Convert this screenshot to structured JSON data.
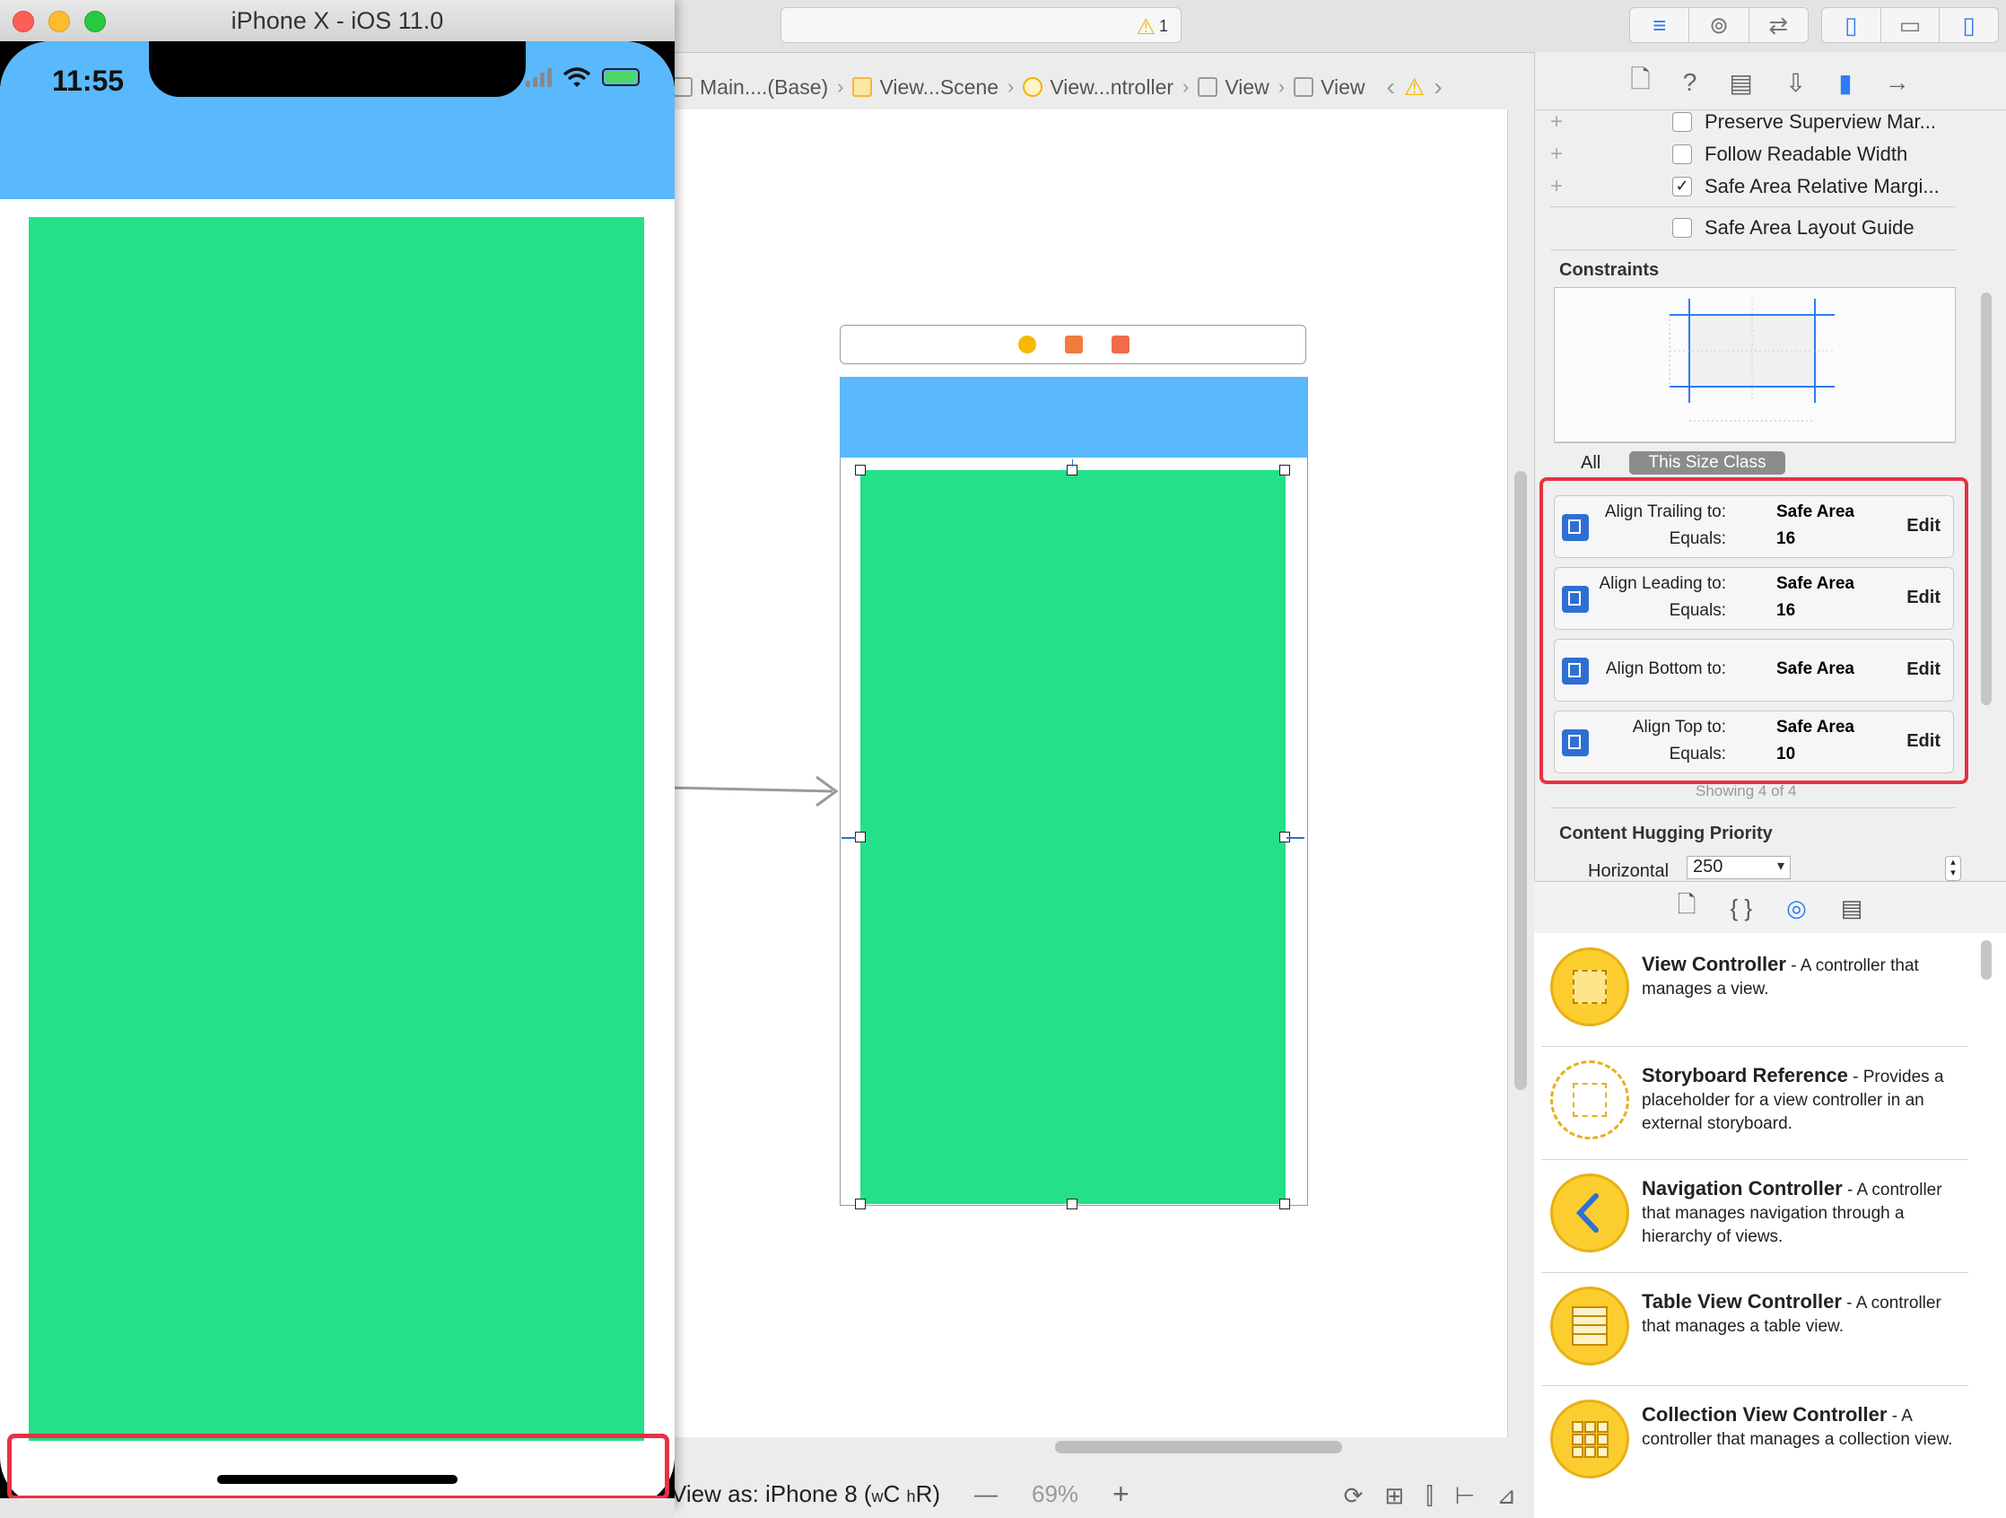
{
  "simulator": {
    "window_title": "iPhone X - iOS 11.0",
    "time": "11:55",
    "colors": {
      "nav_bar": "#5ab8fc",
      "content_view": "#24e088"
    }
  },
  "toolbar": {
    "activity_warning_count": "1"
  },
  "jumpbar": {
    "items": [
      "Main....(Base)",
      "View...Scene",
      "View...ntroller",
      "View",
      "View"
    ]
  },
  "canvas": {
    "view_as": "View as: iPhone 8 (",
    "view_as_w": "w",
    "view_as_c": "C ",
    "view_as_h": "h",
    "view_as_r": "R)",
    "zoom_minus": "—",
    "zoom_level": "69%",
    "zoom_plus": "+"
  },
  "inspector": {
    "checkboxes": [
      {
        "label": "Preserve Superview Mar...",
        "checked": false
      },
      {
        "label": "Follow Readable Width",
        "checked": false
      },
      {
        "label": "Safe Area Relative Margi...",
        "checked": true
      },
      {
        "label": "Safe Area Layout Guide",
        "checked": false
      }
    ],
    "constraints_title": "Constraints",
    "filter_all": "All",
    "filter_size_class": "This Size Class",
    "constraints": [
      {
        "label": "Align Trailing to:",
        "target": "Safe Area",
        "equals_label": "Equals:",
        "equals": "16",
        "edit": "Edit"
      },
      {
        "label": "Align Leading to:",
        "target": "Safe Area",
        "equals_label": "Equals:",
        "equals": "16",
        "edit": "Edit"
      },
      {
        "label": "Align Bottom to:",
        "target": "Safe Area",
        "edit": "Edit"
      },
      {
        "label": "Align Top to:",
        "target": "Safe Area",
        "equals_label": "Equals:",
        "equals": "10",
        "edit": "Edit"
      }
    ],
    "showing": "Showing 4 of 4",
    "hugging_title": "Content Hugging Priority",
    "horizontal_label": "Horizontal",
    "horizontal_value": "250"
  },
  "library": {
    "items": [
      {
        "name": "View Controller",
        "desc": " - A controller that manages a view."
      },
      {
        "name": "Storyboard Reference",
        "desc": " - Provides a placeholder for a view controller in an external storyboard."
      },
      {
        "name": "Navigation Controller",
        "desc": " - A controller that manages navigation through a hierarchy of views."
      },
      {
        "name": "Table View Controller",
        "desc": " - A controller that manages a table view."
      },
      {
        "name": "Collection View Controller",
        "desc": " - A controller that manages a collection view."
      }
    ]
  }
}
